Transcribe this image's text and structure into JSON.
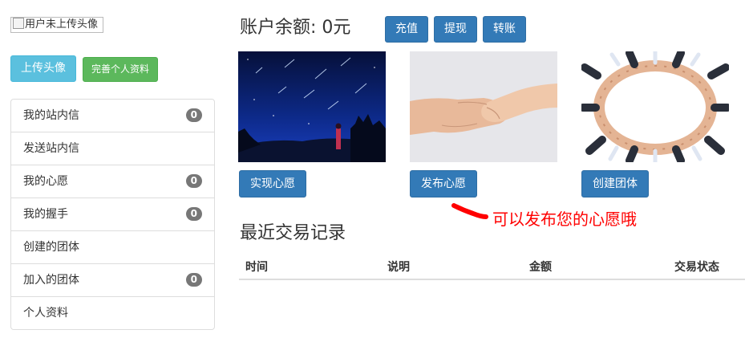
{
  "sidebar": {
    "avatar_alt": "用户未上传头像",
    "upload_avatar_label": "上传头像",
    "complete_profile_label": "完善个人资料",
    "items": [
      {
        "label": "我的站内信",
        "badge": "0"
      },
      {
        "label": "发送站内信"
      },
      {
        "label": "我的心愿",
        "badge": "0"
      },
      {
        "label": "我的握手",
        "badge": "0"
      },
      {
        "label": "创建的团体"
      },
      {
        "label": "加入的团体",
        "badge": "0"
      },
      {
        "label": "个人资料"
      }
    ]
  },
  "account": {
    "balance_label": "账户余额: 0元",
    "recharge_label": "充值",
    "withdraw_label": "提现",
    "transfer_label": "转账"
  },
  "cards": [
    {
      "image": "night-sky-meteor-image",
      "button_label": "实现心愿"
    },
    {
      "image": "handshake-image",
      "button_label": "发布心愿"
    },
    {
      "image": "hands-circle-image",
      "button_label": "创建团体"
    }
  ],
  "annotation": {
    "text": "可以发布您的心愿哦",
    "color": "#ff0000"
  },
  "transactions": {
    "title": "最近交易记录",
    "columns": [
      "时间",
      "说明",
      "金额",
      "交易状态"
    ],
    "rows": []
  },
  "colors": {
    "primary": "#337ab7",
    "info": "#5bc0de",
    "success": "#5cb85c",
    "badge": "#777777"
  }
}
